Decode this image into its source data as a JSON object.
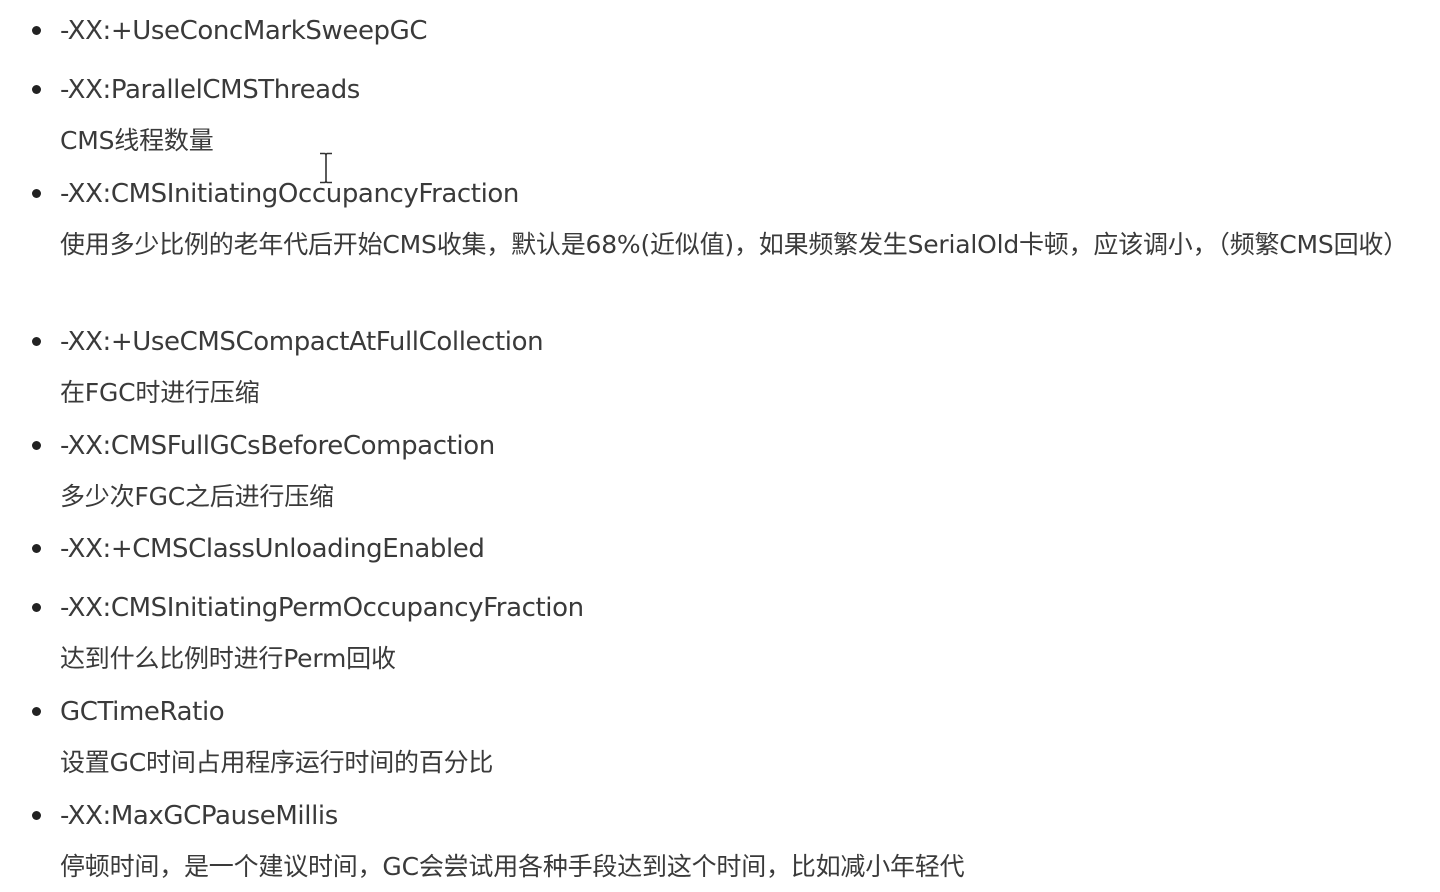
{
  "items": [
    {
      "option": "-XX:+UseConcMarkSweepGC",
      "description": ""
    },
    {
      "option": "-XX:ParallelCMSThreads",
      "description": "CMS线程数量"
    },
    {
      "option": "-XX:CMSInitiatingOccupancyFraction",
      "description": "使用多少比例的老年代后开始CMS收集，默认是68%(近似值)，如果频繁发生SerialOld卡顿，应该调小，（频繁CMS回收）"
    },
    {
      "option": "-XX:+UseCMSCompactAtFullCollection",
      "description": "在FGC时进行压缩"
    },
    {
      "option": "-XX:CMSFullGCsBeforeCompaction",
      "description": "多少次FGC之后进行压缩"
    },
    {
      "option": "-XX:+CMSClassUnloadingEnabled",
      "description": ""
    },
    {
      "option": "-XX:CMSInitiatingPermOccupancyFraction",
      "description": "达到什么比例时进行Perm回收"
    },
    {
      "option": "GCTimeRatio",
      "description": "设置GC时间占用程序运行时间的百分比"
    },
    {
      "option": "-XX:MaxGCPauseMillis",
      "description": "停顿时间，是一个建议时间，GC会尝试用各种手段达到这个时间，比如减小年轻代"
    }
  ]
}
